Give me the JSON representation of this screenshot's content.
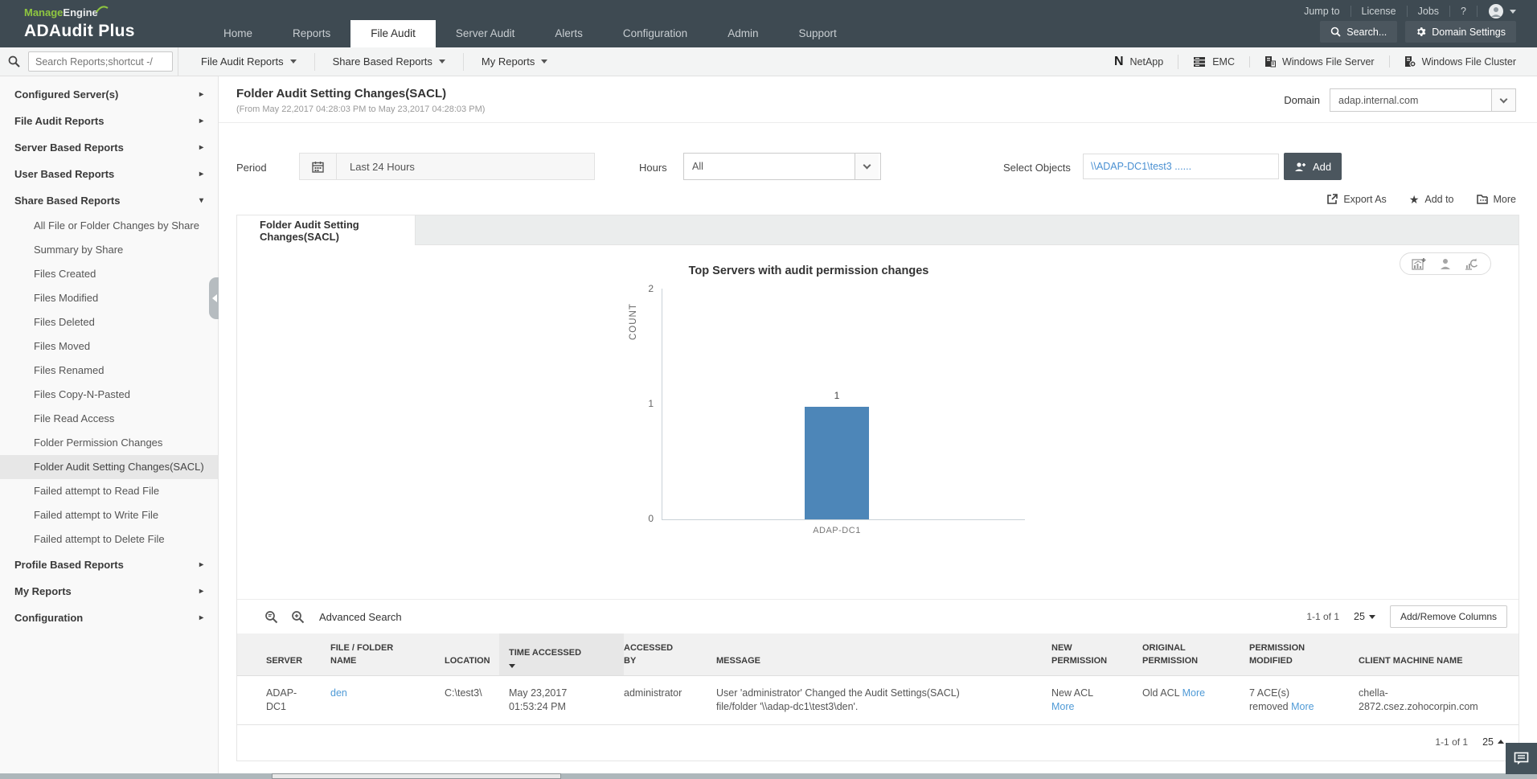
{
  "brand": {
    "manage": "Manage",
    "engine": "Engine",
    "product": "ADAudit Plus"
  },
  "top_nav": {
    "items": [
      "Home",
      "Reports",
      "File Audit",
      "Server Audit",
      "Alerts",
      "Configuration",
      "Admin",
      "Support"
    ],
    "active": "File Audit"
  },
  "utility_nav": {
    "items": [
      "Jump to",
      "License",
      "Jobs",
      "?"
    ]
  },
  "header_buttons": {
    "search": "Search...",
    "domain_settings": "Domain Settings"
  },
  "toolbar": {
    "search_placeholder": "Search Reports;shortcut -/",
    "menus": [
      "File Audit Reports",
      "Share Based Reports",
      "My Reports"
    ],
    "vendors": [
      "NetApp",
      "EMC",
      "Windows File Server",
      "Windows File Cluster"
    ]
  },
  "sidebar": {
    "groups_top": [
      "Configured Server(s)",
      "File Audit Reports",
      "Server Based Reports",
      "User Based Reports",
      "Share Based Reports"
    ],
    "share_items": [
      "All File or Folder Changes by Share",
      "Summary by Share",
      "Files Created",
      "Files Modified",
      "Files Deleted",
      "Files Moved",
      "Files Renamed",
      "Files Copy-N-Pasted",
      "File Read Access",
      "Folder Permission Changes",
      "Folder Audit Setting Changes(SACL)",
      "Failed attempt to Read File",
      "Failed attempt to Write File",
      "Failed attempt to Delete File"
    ],
    "groups_bottom": [
      "Profile Based Reports",
      "My Reports",
      "Configuration"
    ],
    "selected_item": "Folder Audit Setting Changes(SACL)"
  },
  "report": {
    "title": "Folder Audit Setting Changes(SACL)",
    "subtitle": "(From May 22,2017 04:28:03 PM to May 23,2017 04:28:03 PM)",
    "domain_label": "Domain",
    "domain_value": "adap.internal.com",
    "period_label": "Period",
    "period_value": "Last 24 Hours",
    "hours_label": "Hours",
    "hours_value": "All",
    "select_objects_label": "Select Objects",
    "select_objects_value": "\\\\ADAP-DC1\\test3 ......",
    "add_button": "Add",
    "actions": {
      "export_as": "Export As",
      "add_to": "Add to",
      "more": "More"
    },
    "tab": "Folder Audit Setting Changes(SACL)"
  },
  "chart_data": {
    "type": "bar",
    "title": "Top Servers with audit permission changes",
    "categories": [
      "ADAP-DC1"
    ],
    "values": [
      1
    ],
    "xlabel": "",
    "ylabel": "COUNT",
    "ylim": [
      0,
      2
    ],
    "yticks": [
      0,
      1,
      2
    ],
    "bar_color": "#4d86b8",
    "grid": false,
    "legend": false
  },
  "table": {
    "advanced_search_label": "Advanced Search",
    "pagination_top": {
      "range": "1-1 of 1",
      "size": "25"
    },
    "add_remove_columns": "Add/Remove Columns",
    "columns": [
      "SERVER",
      "FILE / FOLDER NAME",
      "LOCATION",
      "TIME ACCESSED",
      "ACCESSED BY",
      "MESSAGE",
      "NEW PERMISSION",
      "ORIGINAL PERMISSION",
      "PERMISSION MODIFIED",
      "CLIENT MACHINE NAME"
    ],
    "row": {
      "server": "ADAP-DC1",
      "file_folder_name": "den",
      "location": "C:\\test3\\",
      "time_date": "May 23,2017",
      "time_time": "01:53:24 PM",
      "accessed_by": "administrator",
      "message": "User 'administrator' Changed the Audit Settings(SACL) file/folder '\\\\adap-dc1\\test3\\den'.",
      "new_permission": "New ACL",
      "new_permission_more": "More",
      "original_permission": "Old ACL",
      "original_permission_more": "More",
      "permission_modified": "7 ACE(s) removed",
      "permission_modified_more": "More",
      "client_machine_name": "chella-2872.csez.zohocorpin.com"
    },
    "pagination_bottom": {
      "range": "1-1 of 1",
      "size": "25"
    }
  }
}
